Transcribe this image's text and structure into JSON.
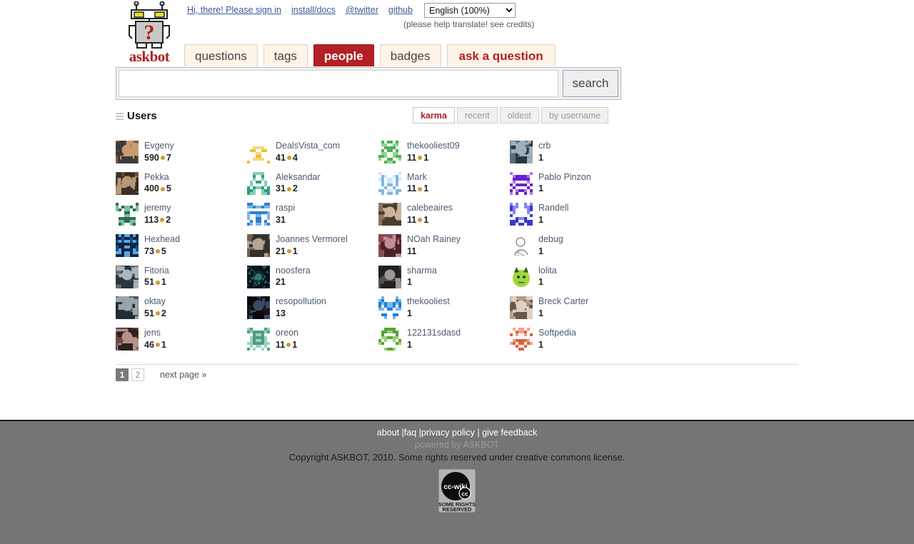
{
  "header": {
    "logo_text": "askbot",
    "logo_icon": "robot-question-mark-icon",
    "links": [
      {
        "label": "Hi, there! Please sign in",
        "name": "signin-link"
      },
      {
        "label": "install/docs",
        "name": "install-docs-link"
      },
      {
        "label": "@twitter",
        "name": "twitter-link"
      },
      {
        "label": "github",
        "name": "github-link"
      }
    ],
    "language": {
      "selected": "English (100%)",
      "options": [
        "English (100%)"
      ]
    },
    "translate_note": "(please help translate! see credits)"
  },
  "nav": {
    "tabs": [
      {
        "label": "questions",
        "active": false
      },
      {
        "label": "tags",
        "active": false
      },
      {
        "label": "people",
        "active": true
      },
      {
        "label": "badges",
        "active": false
      },
      {
        "label": "ask a question",
        "active": false,
        "style": "ask"
      }
    ]
  },
  "search": {
    "value": "",
    "placeholder": "",
    "button_label": "search"
  },
  "users_section": {
    "title": "Users",
    "title_icon": "list-lines-icon",
    "sort": {
      "options": [
        "karma",
        "recent",
        "oldest",
        "by username"
      ],
      "active": "karma"
    },
    "users": [
      {
        "name": "Evgeny",
        "karma": "590",
        "badges": "7",
        "has_badge": true,
        "avatar": "photo",
        "colors": [
          "#8c5a3c",
          "#c89a6e",
          "#3b3b3b"
        ]
      },
      {
        "name": "DealsVista_com",
        "karma": "41",
        "badges": "4",
        "has_badge": true,
        "avatar": "identicon",
        "colors": [
          "#e8c42a",
          "#f2da74",
          "#ffffff"
        ]
      },
      {
        "name": "thekooliest09",
        "karma": "11",
        "badges": "1",
        "has_badge": true,
        "avatar": "identicon",
        "colors": [
          "#4caf50",
          "#8fd694",
          "#ffffff"
        ]
      },
      {
        "name": "crb",
        "karma": "1",
        "badges": "",
        "has_badge": false,
        "avatar": "photo",
        "colors": [
          "#5a6b7a",
          "#9fb0bd",
          "#2d3740"
        ]
      },
      {
        "name": "Pekka",
        "karma": "400",
        "badges": "5",
        "has_badge": true,
        "avatar": "photo",
        "colors": [
          "#6d5540",
          "#b79878",
          "#3a2e24"
        ]
      },
      {
        "name": "Aleksandar",
        "karma": "31",
        "badges": "2",
        "has_badge": true,
        "avatar": "identicon",
        "colors": [
          "#2e9e78",
          "#7fd0b4",
          "#ffffff"
        ]
      },
      {
        "name": "Mark",
        "karma": "11",
        "badges": "1",
        "has_badge": true,
        "avatar": "identicon",
        "colors": [
          "#7fb8e0",
          "#cfe6f7",
          "#ffffff"
        ]
      },
      {
        "name": "Pablo Pinzon",
        "karma": "1",
        "badges": "",
        "has_badge": false,
        "avatar": "identicon",
        "colors": [
          "#6a1fd0",
          "#a978ef",
          "#ffffff"
        ]
      },
      {
        "name": "jeremy",
        "karma": "113",
        "badges": "2",
        "has_badge": true,
        "avatar": "identicon",
        "colors": [
          "#2f6b52",
          "#7dbf9f",
          "#ffffff"
        ]
      },
      {
        "name": "raspi",
        "karma": "31",
        "badges": "",
        "has_badge": false,
        "avatar": "identicon",
        "colors": [
          "#2d7fd0",
          "#7fb6e8",
          "#ffffff"
        ]
      },
      {
        "name": "calebeaires",
        "karma": "11",
        "badges": "1",
        "has_badge": true,
        "avatar": "photo",
        "colors": [
          "#8a7560",
          "#c9b49a",
          "#4a3d30"
        ]
      },
      {
        "name": "Randell",
        "karma": "1",
        "badges": "",
        "has_badge": false,
        "avatar": "identicon",
        "colors": [
          "#3838d8",
          "#8585ee",
          "#ffffff"
        ]
      },
      {
        "name": "Hexhead",
        "karma": "73",
        "badges": "5",
        "has_badge": true,
        "avatar": "identicon",
        "colors": [
          "#1b4f8a",
          "#5fa8e0",
          "#0c2743"
        ]
      },
      {
        "name": "Joannes Vermorel",
        "karma": "21",
        "badges": "1",
        "has_badge": true,
        "avatar": "photo",
        "colors": [
          "#6e6257",
          "#b3a494",
          "#36302a"
        ]
      },
      {
        "name": "NOah Rainey",
        "karma": "11",
        "badges": "",
        "has_badge": false,
        "avatar": "photo",
        "colors": [
          "#8b4a52",
          "#c08f94",
          "#4a2228"
        ]
      },
      {
        "name": "debug",
        "karma": "1",
        "badges": "",
        "has_badge": false,
        "avatar": "sketch",
        "colors": [
          "#ffffff",
          "#7a7a7a",
          "#333333"
        ]
      },
      {
        "name": "Fitoria",
        "karma": "51",
        "badges": "1",
        "has_badge": true,
        "avatar": "photo",
        "colors": [
          "#5f6a74",
          "#a9b4bd",
          "#2c3339"
        ]
      },
      {
        "name": "noosfera",
        "karma": "21",
        "badges": "",
        "has_badge": false,
        "avatar": "space",
        "colors": [
          "#08121c",
          "#2f7a6a",
          "#0d2a33"
        ]
      },
      {
        "name": "sharma",
        "karma": "1",
        "badges": "",
        "has_badge": false,
        "avatar": "photo",
        "colors": [
          "#51504c",
          "#9b9891",
          "#23211f"
        ]
      },
      {
        "name": "lolita",
        "karma": "1",
        "badges": "",
        "has_badge": false,
        "avatar": "monster",
        "colors": [
          "#9fd63b",
          "#cdee86",
          "#3a5a10"
        ]
      },
      {
        "name": "oktay",
        "karma": "51",
        "badges": "2",
        "has_badge": true,
        "avatar": "photo",
        "colors": [
          "#4d5b63",
          "#98a5ac",
          "#242c31"
        ]
      },
      {
        "name": "resopollution",
        "karma": "13",
        "badges": "",
        "has_badge": false,
        "avatar": "photo",
        "colors": [
          "#16161c",
          "#3d4a63",
          "#0a0a0e"
        ]
      },
      {
        "name": "thekooliest",
        "karma": "1",
        "badges": "",
        "has_badge": false,
        "avatar": "identicon",
        "colors": [
          "#1f7fd4",
          "#78b9ea",
          "#ffffff"
        ]
      },
      {
        "name": "Breck Carter",
        "karma": "1",
        "badges": "",
        "has_badge": false,
        "avatar": "photo",
        "colors": [
          "#b89b86",
          "#ded0c2",
          "#6b5747"
        ]
      },
      {
        "name": "jens",
        "karma": "46",
        "badges": "1",
        "has_badge": true,
        "avatar": "photo",
        "colors": [
          "#6b4a45",
          "#b69089",
          "#2e211f"
        ]
      },
      {
        "name": "oreon",
        "karma": "11",
        "badges": "1",
        "has_badge": true,
        "avatar": "identicon",
        "colors": [
          "#4f9c85",
          "#9bd3c3",
          "#ffffff"
        ]
      },
      {
        "name": "122131sdasd",
        "karma": "1",
        "badges": "",
        "has_badge": false,
        "avatar": "identicon",
        "colors": [
          "#55a52e",
          "#9ad178",
          "#ffffff"
        ]
      },
      {
        "name": "Softpedia",
        "karma": "1",
        "badges": "",
        "has_badge": false,
        "avatar": "identicon",
        "colors": [
          "#e0603a",
          "#f0a188",
          "#ffffff"
        ]
      }
    ]
  },
  "pagination": {
    "pages": [
      {
        "label": "1",
        "active": true
      },
      {
        "label": "2",
        "active": false
      }
    ],
    "next_label": "next page »"
  },
  "footer": {
    "links_line": "about |faq |privacy policy | give feedback",
    "links": [
      "about",
      "faq",
      "privacy policy",
      "give feedback"
    ],
    "powered_by": "powered by ASKBOT",
    "copyright": "Copyright ASKBOT, 2010. Some rights reserved under creative commons license.",
    "badge": {
      "main_text": "cc-wiki",
      "sub_text_1": "SOME RIGHTS",
      "sub_text_2": "RESERVED",
      "cc_text": "cc"
    }
  },
  "colors": {
    "accent_red": "#b32025",
    "tab_bg": "#fdf3e7",
    "footer_bg": "#757575",
    "badge_dot": "#cc9b33",
    "link": "#3b5998"
  }
}
